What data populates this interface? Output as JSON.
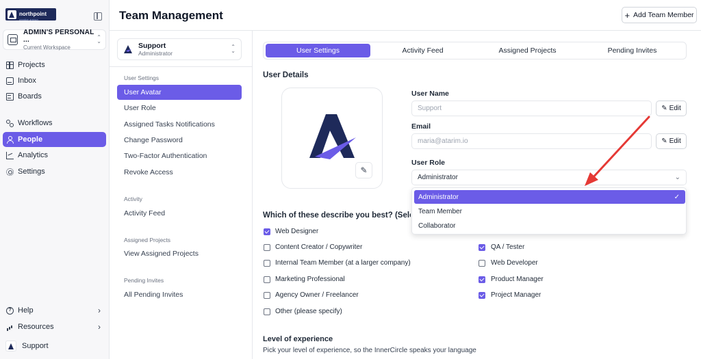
{
  "brand": {
    "name": "northpoint",
    "tagline": "creative agency"
  },
  "workspace": {
    "name": "ADMIN'S PERSONAL ...",
    "subtitle": "Current Workspace"
  },
  "nav": {
    "projects": "Projects",
    "inbox": "Inbox",
    "boards": "Boards",
    "workflows": "Workflows",
    "people": "People",
    "analytics": "Analytics",
    "settings": "Settings",
    "help": "Help",
    "resources": "Resources",
    "current_user": "Support"
  },
  "header": {
    "title": "Team Management",
    "add_member_label": "Add Team Member"
  },
  "user_selector": {
    "name": "Support",
    "role": "Administrator"
  },
  "subnav": {
    "user_settings_heading": "User Settings",
    "user_avatar": "User Avatar",
    "user_role": "User Role",
    "assigned_tasks_notifications": "Assigned Tasks Notifications",
    "change_password": "Change Password",
    "two_factor": "Two-Factor Authentication",
    "revoke_access": "Revoke Access",
    "activity_heading": "Activity",
    "activity_feed": "Activity Feed",
    "assigned_projects_heading": "Assigned Projects",
    "view_assigned_projects": "View Assigned Projects",
    "pending_invites_heading": "Pending Invites",
    "all_pending_invites": "All Pending Invites"
  },
  "tabs": {
    "user_settings": "User Settings",
    "activity_feed": "Activity Feed",
    "assigned_projects": "Assigned Projects",
    "pending_invites": "Pending Invites"
  },
  "user_details": {
    "title": "User Details",
    "username_label": "User Name",
    "username_placeholder": "Support",
    "email_label": "Email",
    "email_placeholder": "maria@atarim.io",
    "edit_label": "Edit",
    "role_label": "User Role",
    "role_value": "Administrator",
    "role_options": {
      "administrator": "Administrator",
      "team_member": "Team Member",
      "collaborator": "Collaborator"
    }
  },
  "question": {
    "title": "Which of these describe you best? (Select all that apply)",
    "web_designer": "Web Designer",
    "content_creator": "Content Creator / Copywriter",
    "internal_team_member": "Internal Team Member (at a larger company)",
    "marketing_professional": "Marketing Professional",
    "agency_owner": "Agency Owner / Freelancer",
    "other": "Other (please specify)",
    "qa_tester": "QA / Tester",
    "web_developer": "Web Developer",
    "product_manager": "Product Manager",
    "project_manager": "Project Manager"
  },
  "experience": {
    "title": "Level of experience",
    "description": "Pick your level of experience, so the InnerCircle speaks your language"
  },
  "colors": {
    "accent": "#6b5ce7",
    "brand_navy": "#1e2a5a",
    "arrow": "#e53935"
  }
}
